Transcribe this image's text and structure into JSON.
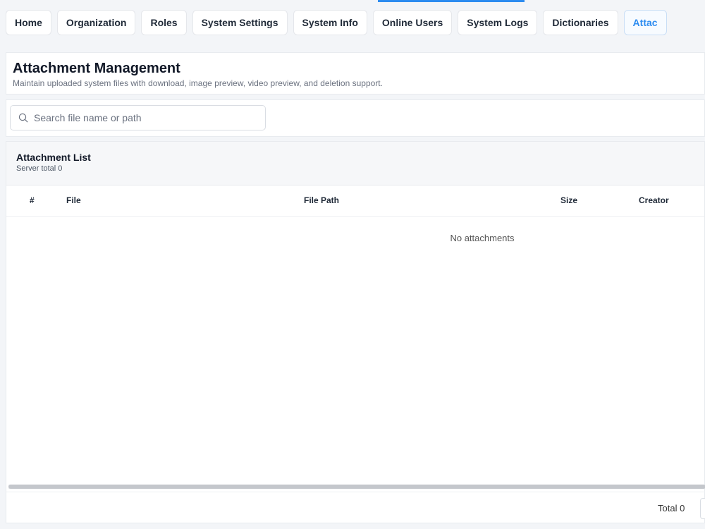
{
  "tabs": [
    {
      "label": "Home"
    },
    {
      "label": "Organization"
    },
    {
      "label": "Roles"
    },
    {
      "label": "System Settings"
    },
    {
      "label": "System Info"
    },
    {
      "label": "Online Users"
    },
    {
      "label": "System Logs"
    },
    {
      "label": "Dictionaries"
    },
    {
      "label": "Attac"
    }
  ],
  "active_tab_color": "#2d8cf0",
  "header": {
    "title": "Attachment Management",
    "subtitle": "Maintain uploaded system files with download, image preview, video preview, and deletion support."
  },
  "search": {
    "placeholder": "Search file name or path",
    "value": "",
    "icon": "search-icon"
  },
  "list": {
    "title": "Attachment List",
    "count_text": "Server total 0",
    "columns": [
      "#",
      "File",
      "File Path",
      "Size",
      "Creator"
    ],
    "empty_text": "No attachments"
  },
  "footer": {
    "total_text": "Total 0"
  }
}
